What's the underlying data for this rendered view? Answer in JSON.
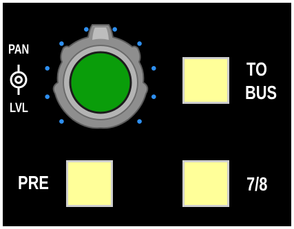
{
  "pan_switch": {
    "top_label": "PAN",
    "bottom_label": "LVL"
  },
  "knob": {
    "cap_color": "#0a9d0a",
    "body_color": "#8e8e8e",
    "led_color": "#2e8ff0",
    "led_count": 10
  },
  "buttons": {
    "to_bus": {
      "label_line1": "TO",
      "label_line2": "BUS",
      "color": "#ffff99"
    },
    "pre": {
      "label": "PRE",
      "color": "#ffff99"
    },
    "seven_eight": {
      "label": "7/8",
      "color": "#ffff99"
    }
  }
}
